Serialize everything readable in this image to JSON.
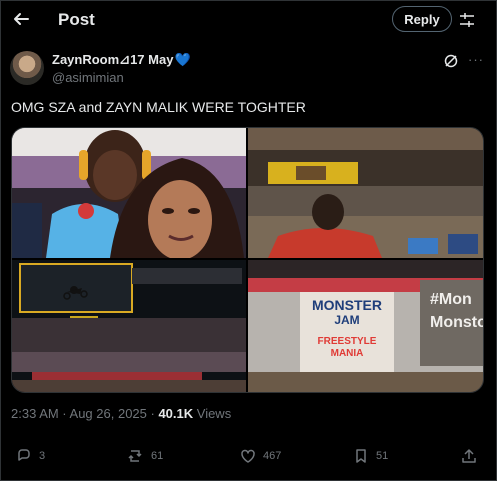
{
  "header": {
    "title": "Post",
    "reply_label": "Reply"
  },
  "author": {
    "name": "ZaynRoom⊿17 May",
    "heart": "💙",
    "handle": "@asimimian"
  },
  "tweet": {
    "text": "OMG SZA and ZAYN MALIK WERE TOGHTER",
    "time": "2:33 AM · Aug 26, 2025 · ",
    "views_count": "40.1K",
    "views_label": " Views"
  },
  "media": {
    "overlays": {
      "monster": "MONSTER",
      "jam": "JAM",
      "freestyle": "FREESTYLE",
      "mania": "MANIA",
      "hash": "#Mon",
      "monsto": "Monsto"
    }
  },
  "actions": {
    "replies": "3",
    "reposts": "61",
    "likes": "467",
    "bookmarks": "51"
  },
  "icons": [
    "back-arrow-icon",
    "tune-icon",
    "grok-icon",
    "more-icon",
    "reply-icon",
    "repost-icon",
    "like-icon",
    "bookmark-icon",
    "share-icon"
  ]
}
